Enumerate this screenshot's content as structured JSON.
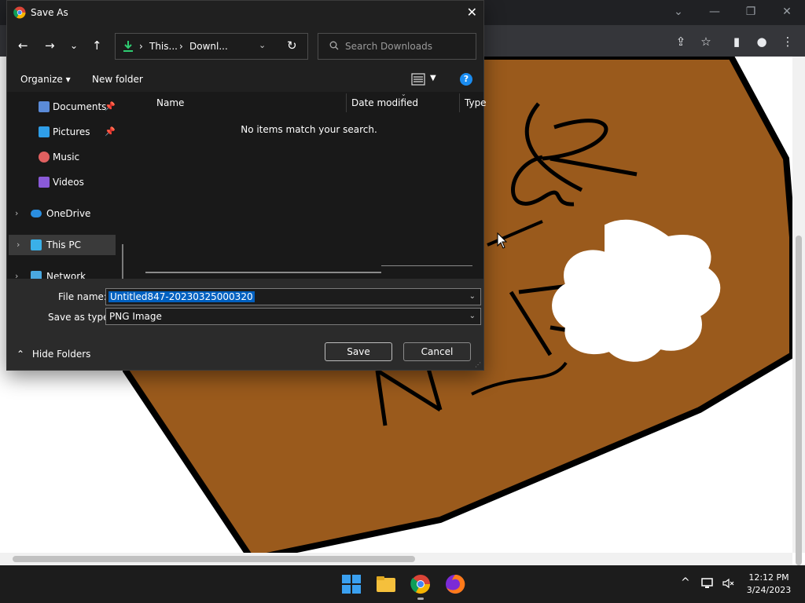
{
  "browser": {
    "window_controls": {
      "collapse": "⌄",
      "minimize": "—",
      "restore": "❐",
      "close": "✕"
    },
    "toolbar_icons": {
      "share": "⇪",
      "star": "☆",
      "sidebar": "▮",
      "profile": "●",
      "menu": "⋮"
    }
  },
  "dialog": {
    "title": "Save As",
    "nav": {
      "back": "←",
      "forward": "→",
      "recent": "⌄",
      "up": "↑"
    },
    "address": {
      "crumb1": "This...",
      "crumb2": "Downl...",
      "separator": "›"
    },
    "search": {
      "placeholder": "Search Downloads"
    },
    "toolbar": {
      "organize": "Organize ▾",
      "new_folder": "New folder"
    },
    "nav_pane": {
      "items": [
        {
          "label": "Documents",
          "pinned": true
        },
        {
          "label": "Pictures",
          "pinned": true
        },
        {
          "label": "Music",
          "pinned": false
        },
        {
          "label": "Videos",
          "pinned": false
        },
        {
          "label": "OneDrive",
          "expandable": true
        },
        {
          "label": "This PC",
          "expandable": true,
          "selected": true
        },
        {
          "label": "Network",
          "expandable": true
        }
      ],
      "pin_glyph": "📌",
      "chevron": "›"
    },
    "columns": [
      "Name",
      "Date modified",
      "Type"
    ],
    "empty_message": "No items match your search.",
    "fields": {
      "file_name_label": "File name:",
      "file_name_value": "Untitled847-20230325000320",
      "save_type_label": "Save as type:",
      "save_type_value": "PNG Image"
    },
    "hide_folders": "Hide Folders",
    "buttons": {
      "save": "Save",
      "cancel": "Cancel"
    }
  },
  "taskbar": {
    "time": "12:12 PM",
    "date": "3/24/2023",
    "tray": {
      "overflow": "^"
    }
  },
  "colors": {
    "dialog_bg": "#191919",
    "accent": "#0060c0",
    "paper_brown": "#9a5a1c",
    "outline": "#000000"
  }
}
